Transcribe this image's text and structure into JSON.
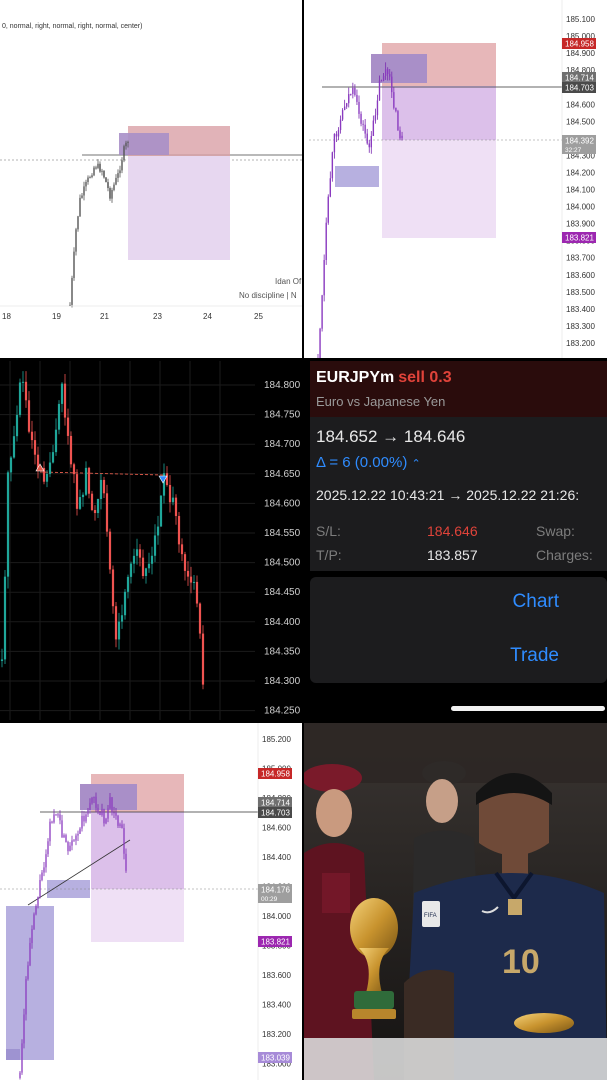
{
  "panel_tl": {
    "header_text": "0, normal, right, normal, right, normal, center)",
    "x_labels": [
      "18",
      "19",
      "21",
      "23",
      "24",
      "25"
    ],
    "watermark_line1": "Idan Of",
    "watermark_line2": "No discipline | N"
  },
  "panel_tr": {
    "price_ticks": [
      "185.100",
      "185.000",
      "184.900",
      "184.800",
      "184.700",
      "184.600",
      "184.500",
      "184.400",
      "184.300",
      "184.200",
      "184.100",
      "184.000",
      "183.900",
      "183.800",
      "183.700",
      "183.600",
      "183.500",
      "183.400",
      "183.300",
      "183.200"
    ],
    "tag_sl": "184.958",
    "tag_entry1": "184.714",
    "tag_entry2": "184.703",
    "tag_current": "184.392",
    "tag_timer": "32:27",
    "tag_tp": "183.821",
    "colors": {
      "sl": "#c62828",
      "entry": "#5f5f5f",
      "current": "#9e9e9e",
      "tp": "#9c27b0"
    }
  },
  "panel_ml": {
    "price_ticks": [
      "184.800",
      "184.750",
      "184.700",
      "184.650",
      "184.600",
      "184.550",
      "184.500",
      "184.450",
      "184.400",
      "184.350",
      "184.300",
      "184.250"
    ]
  },
  "trade": {
    "symbol": "EURJPYm",
    "side": "sell 0.3",
    "description": "Euro vs Japanese Yen",
    "price_line": "184.652 → 184.646",
    "delta_line": "Δ = 6 (0.00%)",
    "delta_icon": "chevron-up-icon",
    "time_line": "2025.12.22 10:43:21 → 2025.12.22 21:26:",
    "sl_label": "S/L:",
    "sl_value": "184.646",
    "swap_label": "Swap:",
    "tp_label": "T/P:",
    "tp_value": "183.857",
    "charges_label": "Charges:",
    "chart_button": "Chart",
    "trade_button": "Trade",
    "colors": {
      "accent": "#2f8cff",
      "sell": "#e0433a"
    }
  },
  "panel_bl": {
    "price_ticks": [
      "185.200",
      "185.000",
      "184.800",
      "184.600",
      "184.400",
      "184.200",
      "184.000",
      "183.800",
      "183.600",
      "183.400",
      "183.200",
      "183.000"
    ],
    "tag_sl": "184.958",
    "tag_entry1": "184.714",
    "tag_entry2": "184.703",
    "tag_current": "184.176",
    "tag_timer": "00:29",
    "tag_tp": "183.821",
    "tag_low": "183.039"
  },
  "photo": {
    "jersey_number": "10",
    "logo_text": "FIFA"
  }
}
